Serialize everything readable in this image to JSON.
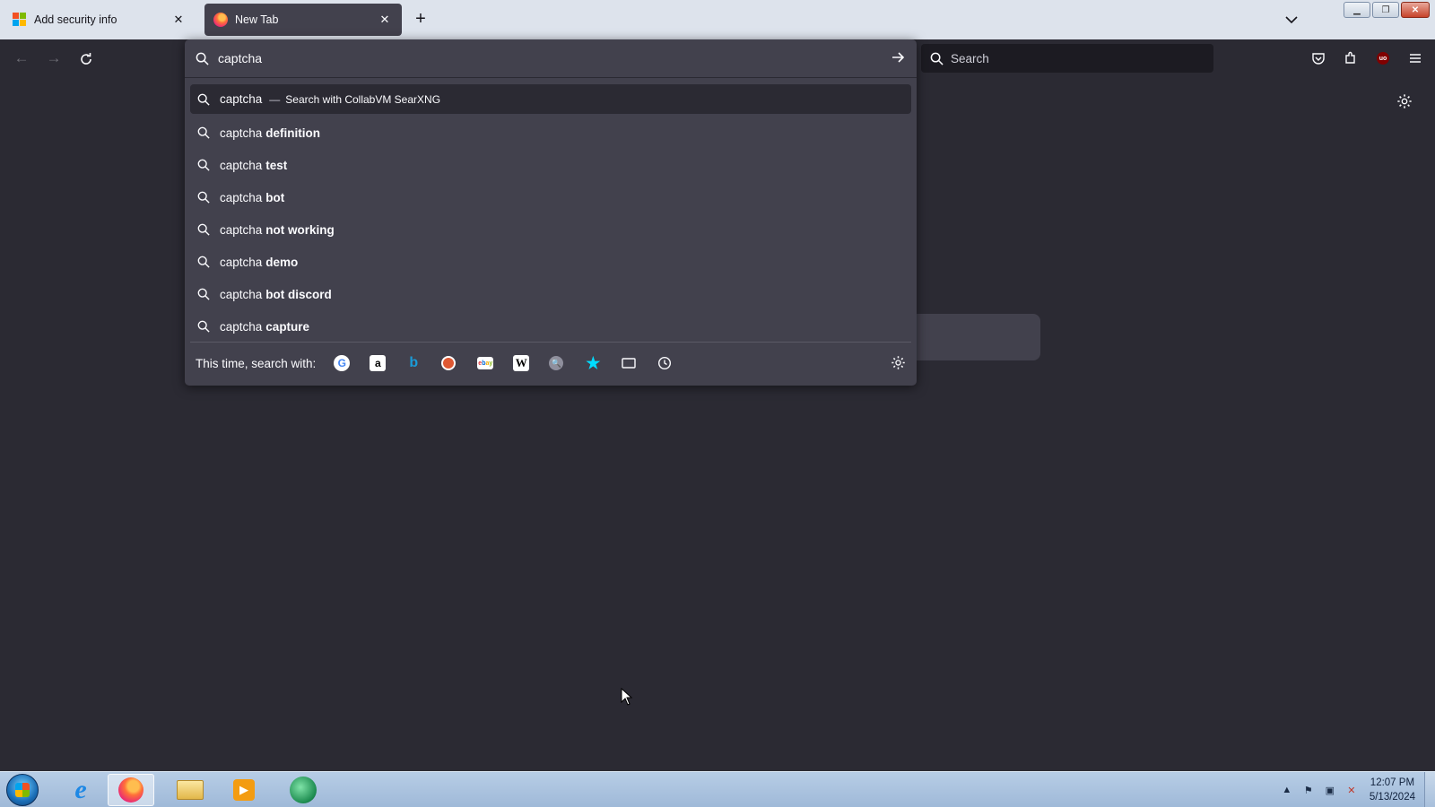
{
  "browser": {
    "tabs": [
      {
        "label": "Add security info",
        "favicon": "microsoft-logo-icon",
        "active": false
      },
      {
        "label": "New Tab",
        "favicon": "firefox-logo-icon",
        "active": true
      }
    ],
    "new_tab_label": "+",
    "toolbar": {
      "search_placeholder": "Search"
    }
  },
  "urlbar": {
    "value": "captcha",
    "suggestions": [
      {
        "query": "captcha",
        "action": "Search with CollabVM SearXNG",
        "separator": "—"
      },
      {
        "query": "captcha",
        "bold": "definition"
      },
      {
        "query": "captcha",
        "bold": "test"
      },
      {
        "query": "captcha",
        "bold": "bot"
      },
      {
        "query": "captcha",
        "bold": "not working"
      },
      {
        "query": "captcha",
        "bold": "demo"
      },
      {
        "query": "captcha",
        "bold": "bot discord"
      },
      {
        "query": "captcha",
        "bold": "capture"
      }
    ],
    "oneoff_label": "This time, search with:",
    "engines": [
      "google-icon",
      "amazon-icon",
      "bing-icon",
      "duckduckgo-icon",
      "ebay-icon",
      "wikipedia-icon",
      "searxng-icon",
      "bookmarks-icon",
      "tabs-icon",
      "history-icon"
    ]
  },
  "taskbar": {
    "clock_time": "12:07 PM",
    "clock_date": "5/13/2024"
  },
  "colors": {
    "toolbar_bg": "#2b2a33",
    "popup_bg": "#42414d",
    "tabstrip_bg": "#dde3ec",
    "accent_blue": "#00ddff"
  }
}
